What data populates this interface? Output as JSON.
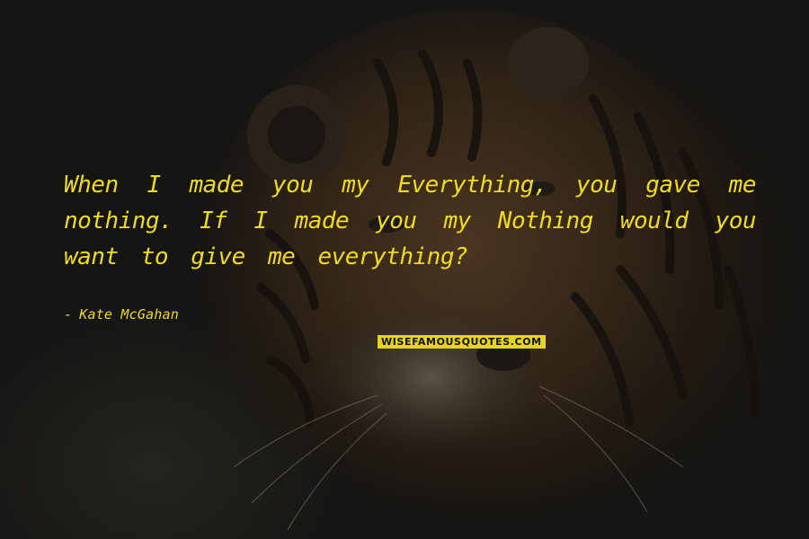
{
  "quote": {
    "text": "When I made you my Everything, you gave me nothing. If I made you my Nothing would you want to give me everything?",
    "author_dash": "-",
    "author": "Kate McGahan"
  },
  "watermark": {
    "text": "WISEFAMOUSQUOTES.COM"
  },
  "background": {
    "subject": "tiger-face-photo"
  },
  "colors": {
    "text": "#f0dc1a",
    "watermark_bg": "#e8d41c",
    "background": "#151513"
  }
}
